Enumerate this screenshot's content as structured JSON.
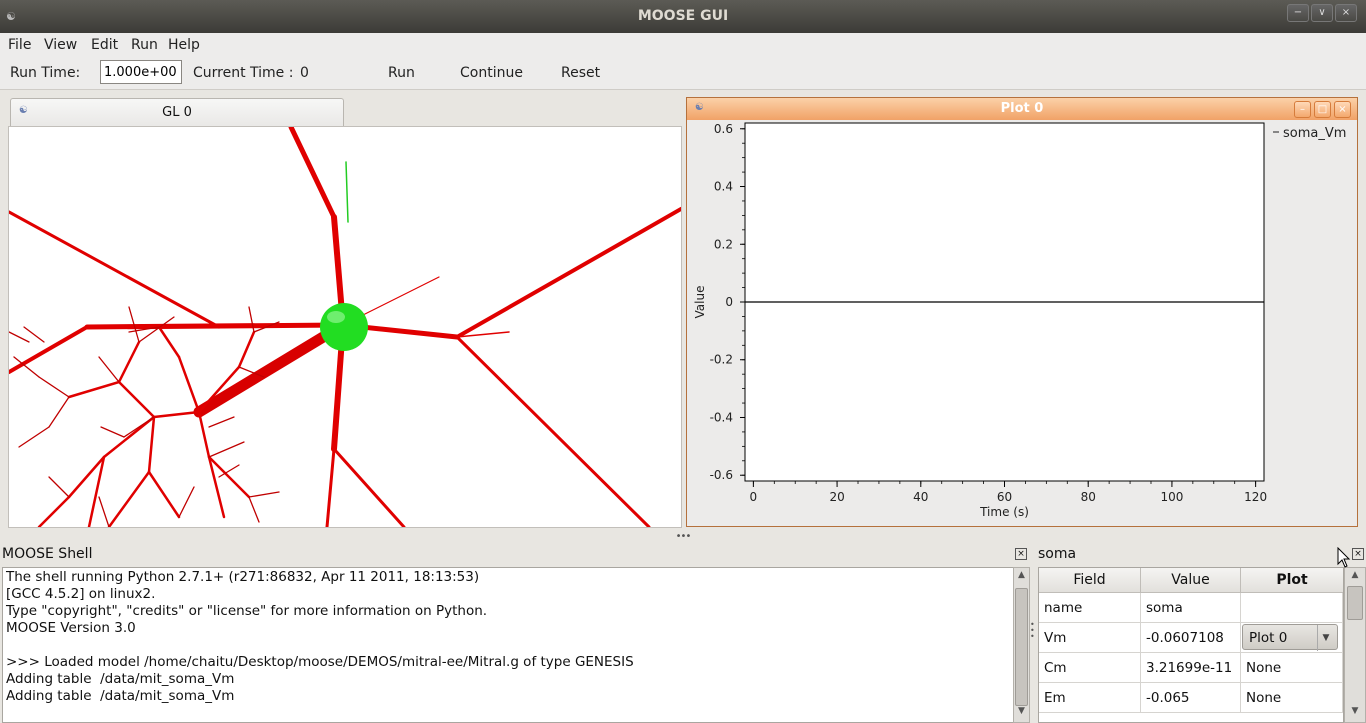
{
  "window": {
    "title": "MOOSE GUI",
    "minimize": "−",
    "maximize": "∨",
    "close": "×"
  },
  "menubar": {
    "items": [
      "File",
      "View",
      "Edit",
      "Run",
      "Help"
    ]
  },
  "toolbar": {
    "run_time_label": "Run Time:",
    "run_time_value": "1.000e+00",
    "current_time_label": "Current Time :",
    "current_time_value": "0",
    "run_label": "Run",
    "continue_label": "Continue",
    "reset_label": "Reset"
  },
  "gl_panel": {
    "tab_title": "GL 0"
  },
  "plot_window": {
    "title": "Plot 0",
    "chart_data": {
      "type": "line",
      "title": "",
      "xlabel": "Time (s)",
      "ylabel": "Value",
      "xlim": [
        -2,
        122
      ],
      "ylim": [
        -0.62,
        0.62
      ],
      "x_ticks": [
        0,
        20,
        40,
        60,
        80,
        100,
        120
      ],
      "y_ticks": [
        0.6,
        0.4,
        0.2,
        0,
        -0.2,
        -0.4,
        -0.6
      ],
      "x_tick_labels": [
        "0",
        "20",
        "40",
        "60",
        "80",
        "100",
        "120"
      ],
      "y_tick_labels": [
        "0.6",
        "0.4",
        "0.2",
        "0",
        "-0.2",
        "-0.4",
        "-0.6"
      ],
      "legend_placement": "right",
      "series": [
        {
          "name": "soma_Vm",
          "x": [
            -2,
            122
          ],
          "values": [
            0,
            0
          ],
          "color": "#000000"
        }
      ]
    }
  },
  "shell": {
    "title": "MOOSE Shell",
    "lines": [
      "The shell running Python 2.7.1+ (r271:86832, Apr 11 2011, 18:13:53)",
      "[GCC 4.5.2] on linux2.",
      "Type \"copyright\", \"credits\" or \"license\" for more information on Python.",
      "MOOSE Version 3.0",
      "",
      ">>> Loaded model /home/chaitu/Desktop/moose/DEMOS/mitral-ee/Mitral.g of type GENESIS",
      "Adding table  /data/mit_soma_Vm",
      "Adding table  /data/mit_soma_Vm"
    ]
  },
  "properties": {
    "title": "soma",
    "headers": [
      "Field",
      "Value",
      "Plot"
    ],
    "rows": [
      {
        "field": "name",
        "value": "soma",
        "plot": ""
      },
      {
        "field": "Vm",
        "value": "-0.0607108",
        "plot": "Plot 0"
      },
      {
        "field": "Cm",
        "value": "3.21699e-11",
        "plot": "None"
      },
      {
        "field": "Em",
        "value": "-0.065",
        "plot": "None"
      }
    ]
  },
  "colors": {
    "dendrite": "#e00000",
    "soma": "#22dd22",
    "plot_titlebar": "#f1a267"
  }
}
